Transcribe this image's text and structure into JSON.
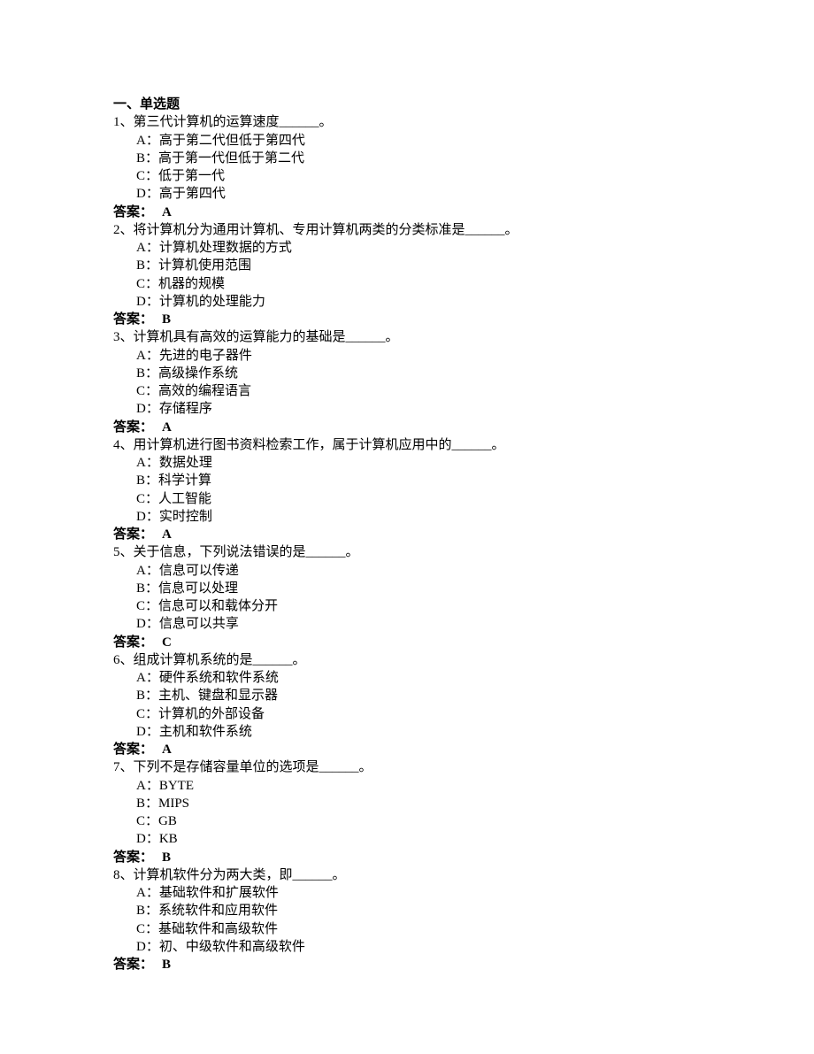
{
  "section_title": "一、单选题",
  "answer_label": "答案：",
  "questions": [
    {
      "number": "1、",
      "text": "第三代计算机的运算速度______。",
      "options": {
        "A": "A：高于第二代但低于第四代",
        "B": "B：高于第一代但低于第二代",
        "C": "C：低于第一代",
        "D": "D：高于第四代"
      },
      "answer": "A"
    },
    {
      "number": "2、",
      "text": "将计算机分为通用计算机、专用计算机两类的分类标准是______。",
      "options": {
        "A": "A：计算机处理数据的方式",
        "B": "B：计算机使用范围",
        "C": "C：机器的规模",
        "D": "D：计算机的处理能力"
      },
      "answer": "B"
    },
    {
      "number": "3、",
      "text": "计算机具有高效的运算能力的基础是______。",
      "options": {
        "A": "A：先进的电子器件",
        "B": "B：高级操作系统",
        "C": "C：高效的编程语言",
        "D": "D：存储程序"
      },
      "answer": "A"
    },
    {
      "number": "4、",
      "text": "用计算机进行图书资料检索工作，属于计算机应用中的______。",
      "options": {
        "A": "A：数据处理",
        "B": "B：科学计算",
        "C": "C：人工智能",
        "D": "D：实时控制"
      },
      "answer": "A"
    },
    {
      "number": "5、",
      "text": "关于信息，下列说法错误的是______。",
      "options": {
        "A": "A：信息可以传递",
        "B": "B：信息可以处理",
        "C": "C：信息可以和载体分开",
        "D": "D：信息可以共享"
      },
      "answer": "C"
    },
    {
      "number": "6、",
      "text": "组成计算机系统的是______。",
      "options": {
        "A": "A：硬件系统和软件系统",
        "B": "B：主机、键盘和显示器",
        "C": "C：计算机的外部设备",
        "D": "D：主机和软件系统"
      },
      "answer": "A"
    },
    {
      "number": "7、",
      "text": "下列不是存储容量单位的选项是______。",
      "options": {
        "A": "A：BYTE",
        "B": "B：MIPS",
        "C": "C：GB",
        "D": "D：KB"
      },
      "answer": "B"
    },
    {
      "number": "8、",
      "text": "计算机软件分为两大类，即______。",
      "options": {
        "A": "A：基础软件和扩展软件",
        "B": "B：系统软件和应用软件",
        "C": "C：基础软件和高级软件",
        "D": "D：初、中级软件和高级软件"
      },
      "answer": "B"
    }
  ]
}
